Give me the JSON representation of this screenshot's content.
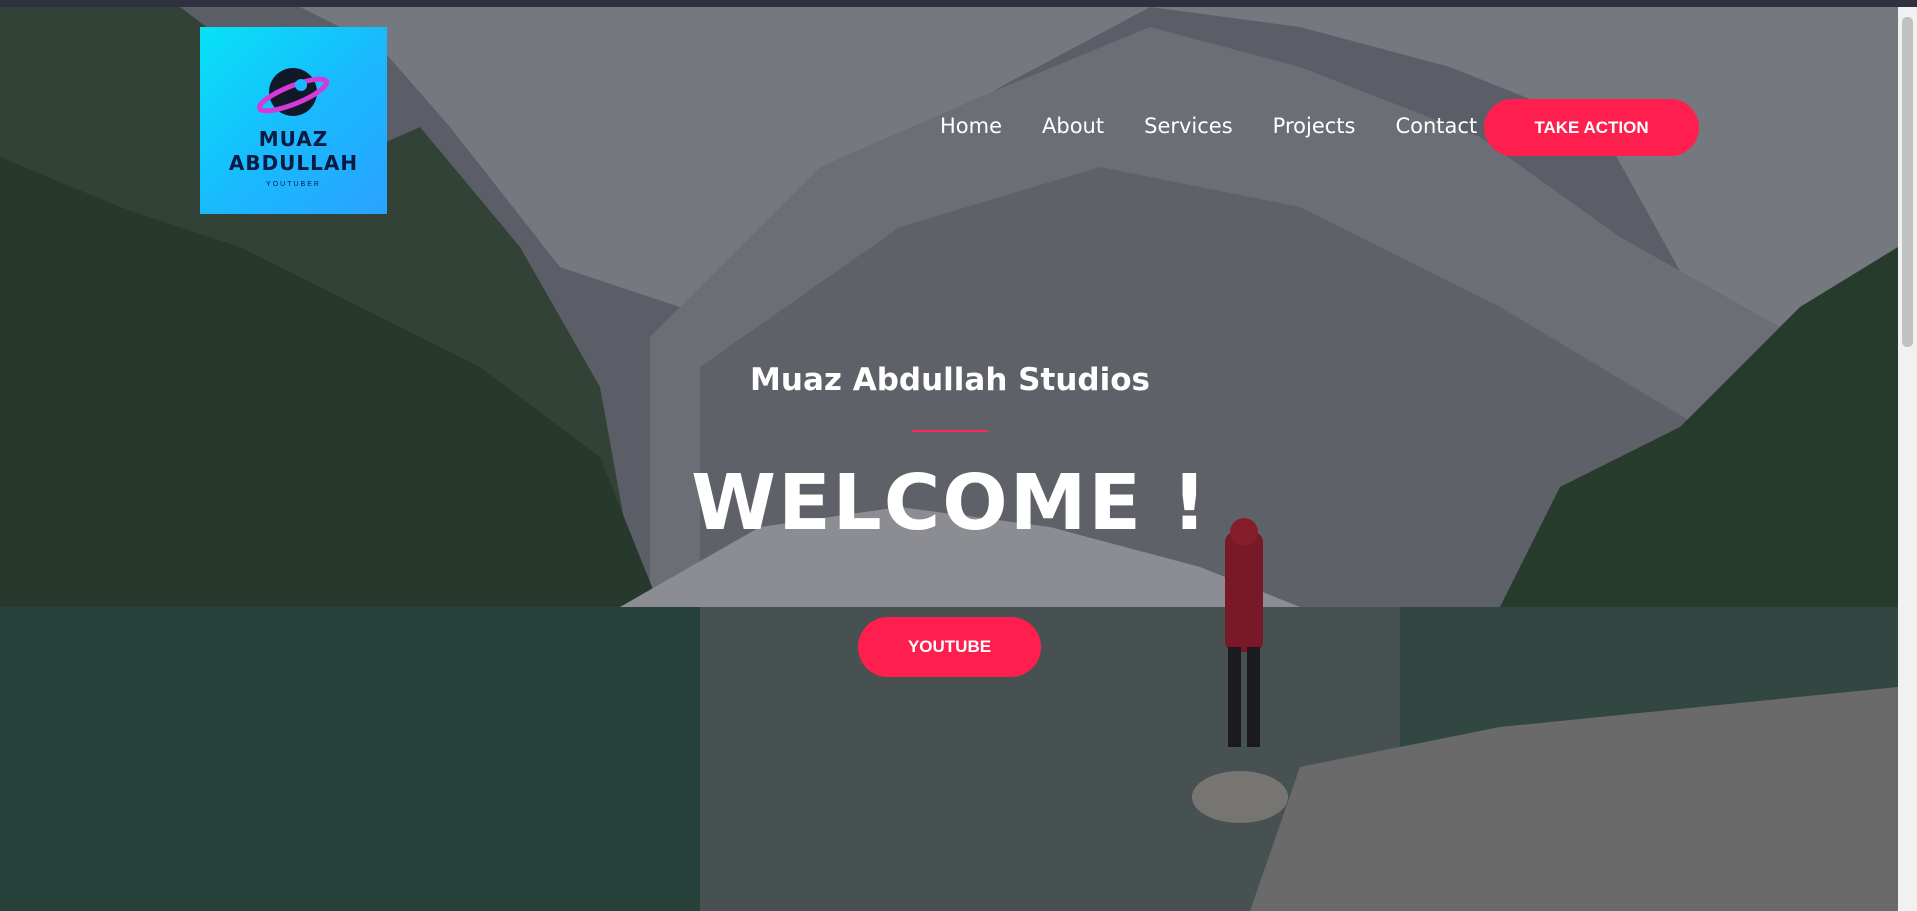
{
  "brand": {
    "logo_name": "MUAZ ABDULLAH",
    "logo_tagline": "YOUTUBER",
    "accent": "#ff1f4f",
    "logo_gradient": [
      "#06e3f5",
      "#2aa2ff"
    ]
  },
  "nav": {
    "items": [
      {
        "label": "Home"
      },
      {
        "label": "About"
      },
      {
        "label": "Services"
      },
      {
        "label": "Projects"
      },
      {
        "label": "Contact"
      }
    ],
    "cta_label": "TAKE ACTION"
  },
  "hero": {
    "subtitle": "Muaz Abdullah Studios",
    "heading": "WELCOME !",
    "button_label": "YOUTUBE",
    "background": "mountain-lake-photo"
  }
}
